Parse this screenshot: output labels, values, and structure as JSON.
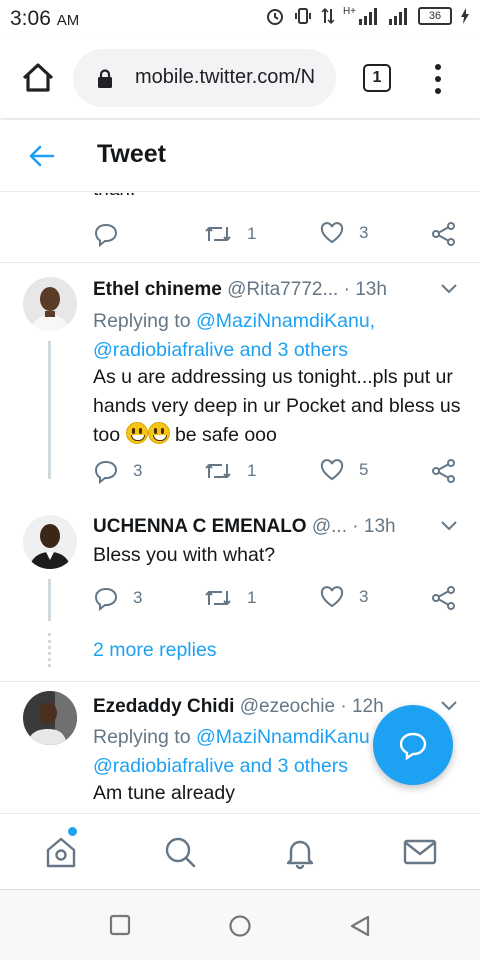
{
  "status_bar": {
    "time": "3:06",
    "ampm": "AM",
    "network": "H+",
    "battery": "36"
  },
  "browser": {
    "url": "mobile.twitter.com/N",
    "tab_count": "1"
  },
  "header": {
    "title": "Tweet"
  },
  "previous_tweet": {
    "cut_text": "than.",
    "retweets": "1",
    "likes": "3"
  },
  "tweets": [
    {
      "name": "Ethel chineme",
      "handle": "@Rita7772...",
      "sep": "·",
      "time": "13h",
      "replying_label": "Replying to",
      "reply_to_1": "@MaziNnamdiKanu,",
      "reply_to_2": "@radiobiafralive and 3 others",
      "text_part1": "As u are addressing us tonight...pls put ur hands very deep in ur Pocket and bless us too",
      "text_part2": "be safe ooo",
      "replies": "3",
      "retweets": "1",
      "likes": "5"
    },
    {
      "name": "UCHENNA C EMENALO",
      "handle": "@...",
      "sep": "·",
      "time": "13h",
      "text": "Bless you with what?",
      "replies": "3",
      "retweets": "1",
      "likes": "3"
    },
    {
      "name": "Ezedaddy Chidi",
      "handle": "@ezeochie",
      "sep": "·",
      "time": "12h",
      "replying_label": "Replying to",
      "reply_to_1": "@MaziNnamdiKanu",
      "reply_to_2": "@radiobiafralive and 3 others",
      "text": "Am tune already"
    }
  ],
  "more_replies": "2 more replies",
  "colors": {
    "accent": "#1da1f2",
    "text": "#14171a",
    "muted": "#657786",
    "divider": "#e6ecf0"
  },
  "icons": {
    "home": "home-icon",
    "search": "search-icon",
    "notifications": "bell-icon",
    "messages": "mail-icon",
    "compose": "compose-reply-icon"
  }
}
